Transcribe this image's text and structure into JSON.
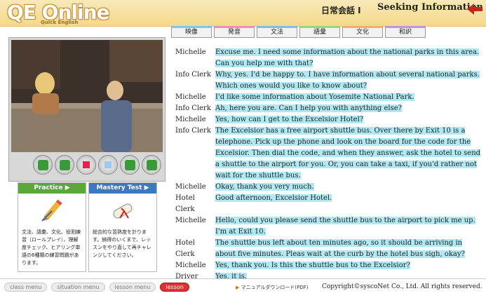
{
  "header": {
    "logo": "QE Online",
    "logo_sub": "Quick English",
    "course": "日常会話 I",
    "title": "Seeking Information"
  },
  "tabs": [
    {
      "label": "映像",
      "color": "#7fc6e8"
    },
    {
      "label": "発音",
      "color": "#f08fb0"
    },
    {
      "label": "文法",
      "color": "#8ab8e8"
    },
    {
      "label": "語彙",
      "color": "#9fd07a"
    },
    {
      "label": "文化",
      "color": "#f0b070"
    },
    {
      "label": "和訳",
      "color": "#b898d8"
    }
  ],
  "practice": {
    "label": "Practice ▶",
    "color": "#5aa83a",
    "description": "文法、語彙、文化、役割練習（ロールプレイ）、理解度チェック、ヒアリング単語の6種類の練習問題があります。"
  },
  "mastery": {
    "label": "Mastery Test ▶",
    "color": "#3a78c0",
    "description": "総合的な習熟度を計ります。納得のいくまで、レッスンをやり直して再チャレンジしてください。"
  },
  "transcript": [
    {
      "speaker": "Michelle",
      "text": "Excuse me. I need some information about the national parks in this area. Can you help me with that?"
    },
    {
      "speaker": "Info Clerk",
      "text": "Why, yes. I'd be happy to. I have information about several national parks. Which ones would you like to know about?"
    },
    {
      "speaker": "Michelle",
      "text": "I'd like some information about Yosemite National Park."
    },
    {
      "speaker": "Info Clerk",
      "text": "Ah, here you are. Can I help you with anything else?"
    },
    {
      "speaker": "Michelle",
      "text": "Yes, how can I get to the Excelsior Hotel?"
    },
    {
      "speaker": "Info Clerk",
      "text": "The Excelsior has a free airport shuttle bus. Over there by Exit 10 is a telephone. Pick up the phone and look on the board for the code for the Excelsior. Then dial the code, and when they answer, ask the hotel to send a shuttle to the airport for you. Or, you can take a taxi, if you'd rather not wait for the shuttle bus."
    },
    {
      "speaker": "Michelle",
      "text": "Okay, thank you very much."
    },
    {
      "speaker": "Hotel Clerk",
      "text": "Good afternoon, Excelsior Hotel."
    },
    {
      "speaker": "Michelle",
      "text": "Hello, could you please send the shuttle bus to the airport to pick me up. I'm at Exit 10."
    },
    {
      "speaker": "Hotel Clerk",
      "text": "The shuttle bus left about ten minutes ago, so it should be arriving in about five minutes. Pleas wait at the curb by the hotel bus sigh, okay?"
    },
    {
      "speaker": "Michelle",
      "text": "Yes, thank you. Is this the shuttle bus to the Excelsior?"
    },
    {
      "speaker": "Driver",
      "text": "Yes, it is."
    }
  ],
  "breadcrumbs": [
    {
      "label": "class menu",
      "active": false
    },
    {
      "label": "situation menu",
      "active": false
    },
    {
      "label": "lesson menu",
      "active": false
    },
    {
      "label": "lesson",
      "active": true
    }
  ],
  "footer": {
    "manual": "マニュアルダウンロード(PDF)",
    "copyright": "Copyright©syscoNet Co., Ltd. All rights reserved."
  }
}
